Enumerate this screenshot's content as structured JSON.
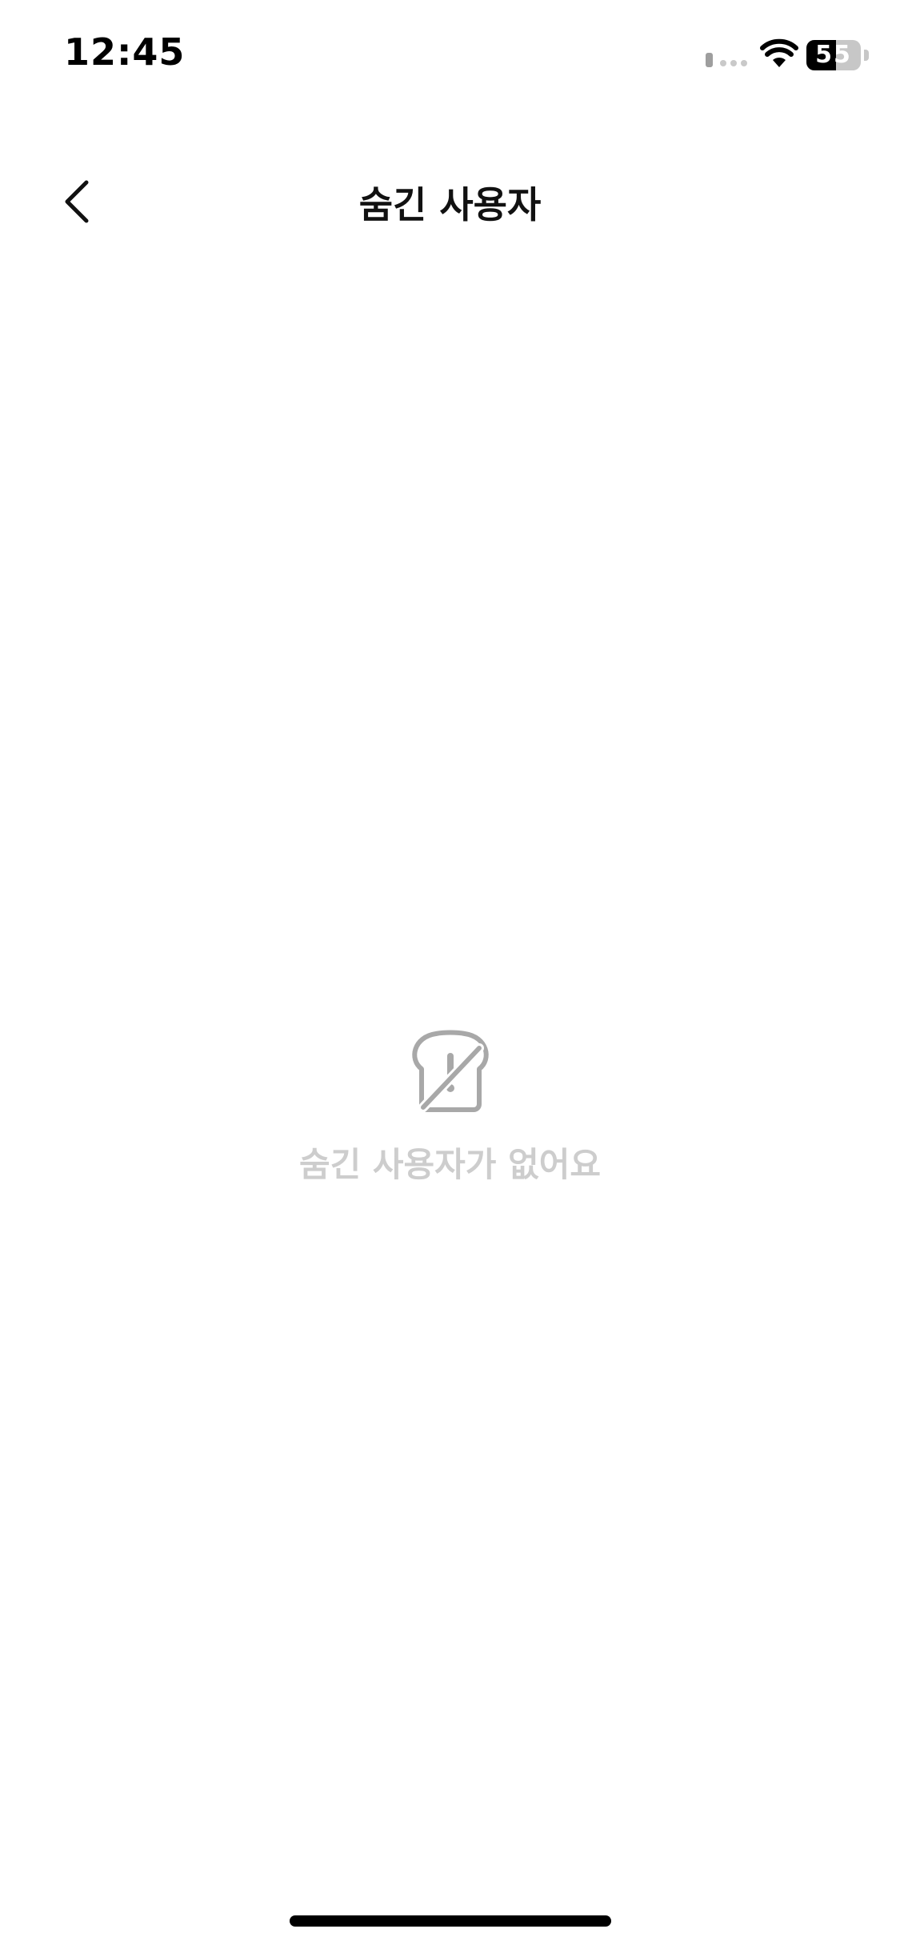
{
  "status_bar": {
    "time": "12:45",
    "battery_label": "55",
    "battery_level": 0.55,
    "icons": [
      "signal-icon",
      "wifi-icon",
      "battery-icon"
    ]
  },
  "nav": {
    "title": "숨긴 사용자",
    "back_icon": "chevron-left-icon"
  },
  "empty_state": {
    "icon": "bread-slashed-icon",
    "message": "숨긴 사용자가 없어요"
  },
  "colors": {
    "title": "#111111",
    "empty_icon": "#a8a8a8",
    "empty_text": "#cdcdcd",
    "background": "#ffffff"
  }
}
